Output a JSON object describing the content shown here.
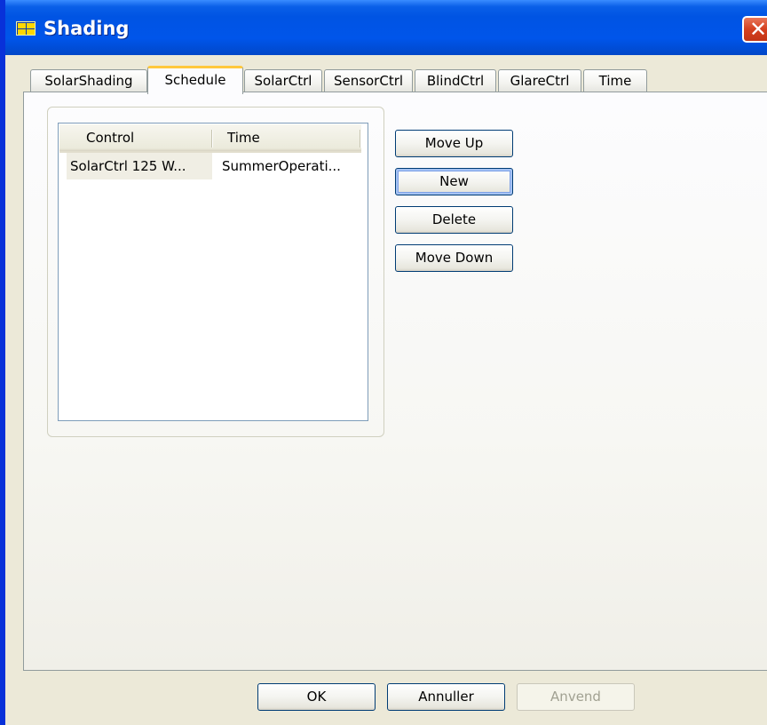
{
  "window": {
    "title": "Shading",
    "close_glyph": "✕",
    "icon": "window-grid-icon"
  },
  "tabs": [
    {
      "label": "SolarShading",
      "active": false
    },
    {
      "label": "Schedule",
      "active": true
    },
    {
      "label": "SolarCtrl",
      "active": false
    },
    {
      "label": "SensorCtrl",
      "active": false
    },
    {
      "label": "BlindCtrl",
      "active": false
    },
    {
      "label": "GlareCtrl",
      "active": false
    },
    {
      "label": "Time",
      "active": false
    }
  ],
  "schedule": {
    "columns": [
      "Control",
      "Time"
    ],
    "rows": [
      {
        "control": "SolarCtrl 125 W...",
        "time": "SummerOperati..."
      }
    ],
    "buttons": {
      "move_up": "Move Up",
      "new": "New",
      "delete": "Delete",
      "move_down": "Move Down"
    }
  },
  "footer": {
    "ok": "OK",
    "cancel": "Annuller",
    "apply": "Anvend"
  },
  "colors": {
    "titlebar": "#0054e3",
    "dialog_bg": "#ece9d8",
    "active_tab_accent": "#ffc83c",
    "close_button": "#d5401f"
  }
}
